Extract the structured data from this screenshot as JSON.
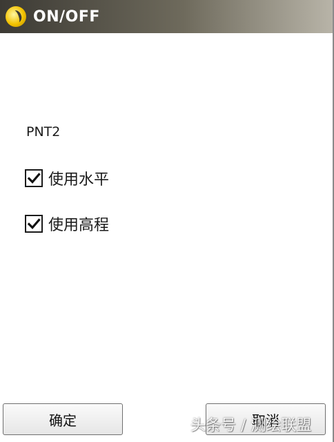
{
  "window": {
    "title": "ON/OFF",
    "icon": "app-logo-icon",
    "colors": {
      "titlebar_dark": "#3c3a34",
      "titlebar_light": "#b8b4a8",
      "logo": "#f2c200"
    }
  },
  "content": {
    "point_name": "PNT2",
    "options": [
      {
        "label": "使用水平",
        "checked": true
      },
      {
        "label": "使用高程",
        "checked": true
      }
    ]
  },
  "buttons": {
    "ok_label": "确定",
    "cancel_label": "取消"
  },
  "watermark": {
    "text": "头条号 / 测绘联盟"
  }
}
